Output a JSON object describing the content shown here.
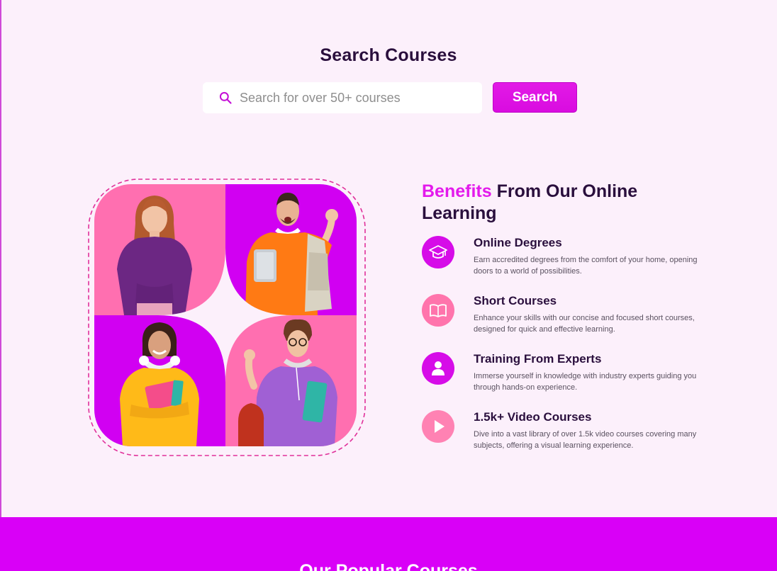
{
  "search": {
    "title": "Search Courses",
    "placeholder": "Search for over 50+ courses",
    "button_label": "Search"
  },
  "benefits": {
    "title_accent": "Benefits",
    "title_rest": " From Our Online Learning",
    "items": [
      {
        "icon": "graduation-cap-icon",
        "title": "Online Degrees",
        "description": "Earn accredited degrees from the comfort of your home, opening doors to a world of possibilities."
      },
      {
        "icon": "book-icon",
        "title": "Short Courses",
        "description": "Enhance your skills with our concise and focused short courses, designed for quick and effective learning."
      },
      {
        "icon": "user-icon",
        "title": "Training From Experts",
        "description": "Immerse yourself in knowledge with industry experts guiding you through hands-on experience."
      },
      {
        "icon": "play-icon",
        "title": "1.5k+ Video Courses",
        "description": "Dive into a vast library of over 1.5k video courses covering many subjects, offering a visual learning experience."
      }
    ]
  },
  "popular": {
    "heading": "Our Popular Courses"
  },
  "colors": {
    "accent": "#e31aec",
    "band": "#d900f7",
    "pink": "#ff6fb0",
    "purple": "#d100f2",
    "background": "#fcf0fb",
    "dark_text": "#2a0f3d"
  }
}
